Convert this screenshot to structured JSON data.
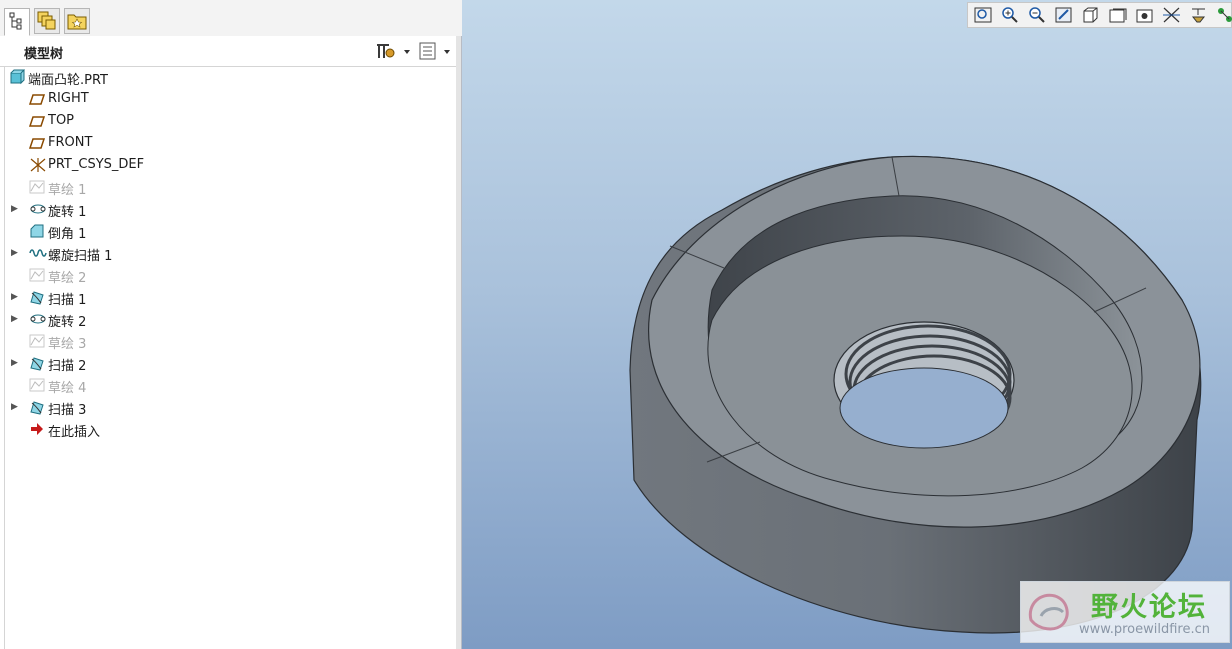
{
  "panel": {
    "title": "模型树",
    "tabs": [
      "model-tree-tab",
      "layer-tab",
      "favorites-tab"
    ]
  },
  "tree": {
    "items": [
      {
        "label": "端面凸轮.PRT",
        "icon": "part-icon",
        "expandable": false,
        "dim": false
      },
      {
        "label": "RIGHT",
        "icon": "datum-plane-icon",
        "expandable": false,
        "dim": false
      },
      {
        "label": "TOP",
        "icon": "datum-plane-icon",
        "expandable": false,
        "dim": false
      },
      {
        "label": "FRONT",
        "icon": "datum-plane-icon",
        "expandable": false,
        "dim": false
      },
      {
        "label": "PRT_CSYS_DEF",
        "icon": "csys-icon",
        "expandable": false,
        "dim": false
      },
      {
        "label": "草绘 1",
        "icon": "sketch-icon",
        "expandable": false,
        "dim": true
      },
      {
        "label": "旋转 1",
        "icon": "revolve-icon",
        "expandable": true,
        "dim": false
      },
      {
        "label": "倒角 1",
        "icon": "chamfer-icon",
        "expandable": false,
        "dim": false
      },
      {
        "label": "螺旋扫描 1",
        "icon": "helical-sweep-icon",
        "expandable": true,
        "dim": false
      },
      {
        "label": "草绘 2",
        "icon": "sketch-icon",
        "expandable": false,
        "dim": true
      },
      {
        "label": "扫描 1",
        "icon": "sweep-icon",
        "expandable": true,
        "dim": false
      },
      {
        "label": "旋转 2",
        "icon": "revolve-icon",
        "expandable": true,
        "dim": false
      },
      {
        "label": "草绘 3",
        "icon": "sketch-icon",
        "expandable": false,
        "dim": true
      },
      {
        "label": "扫描 2",
        "icon": "sweep-icon",
        "expandable": true,
        "dim": false
      },
      {
        "label": "草绘 4",
        "icon": "sketch-icon",
        "expandable": false,
        "dim": true
      },
      {
        "label": "扫描 3",
        "icon": "sweep-icon",
        "expandable": true,
        "dim": false
      },
      {
        "label": "在此插入",
        "icon": "insert-here-arrow-icon",
        "expandable": false,
        "dim": false
      }
    ]
  },
  "view_toolbar": {
    "buttons": [
      "zoom-fit-icon",
      "zoom-in-icon",
      "zoom-out-icon",
      "repaint-icon",
      "display-style-icon",
      "saved-views-icon",
      "view-manager-icon",
      "datum-display-icon",
      "annotation-display-icon",
      "spin-center-icon"
    ]
  },
  "watermark": {
    "title": "野火论坛",
    "url": "www.proewildfire.cn"
  },
  "colors": {
    "viewport_top": "#c3d8ea",
    "viewport_bottom": "#7e9cc4",
    "model_face": "#8b9299",
    "model_side": "#5a6068",
    "watermark_green": "#52b33a"
  }
}
